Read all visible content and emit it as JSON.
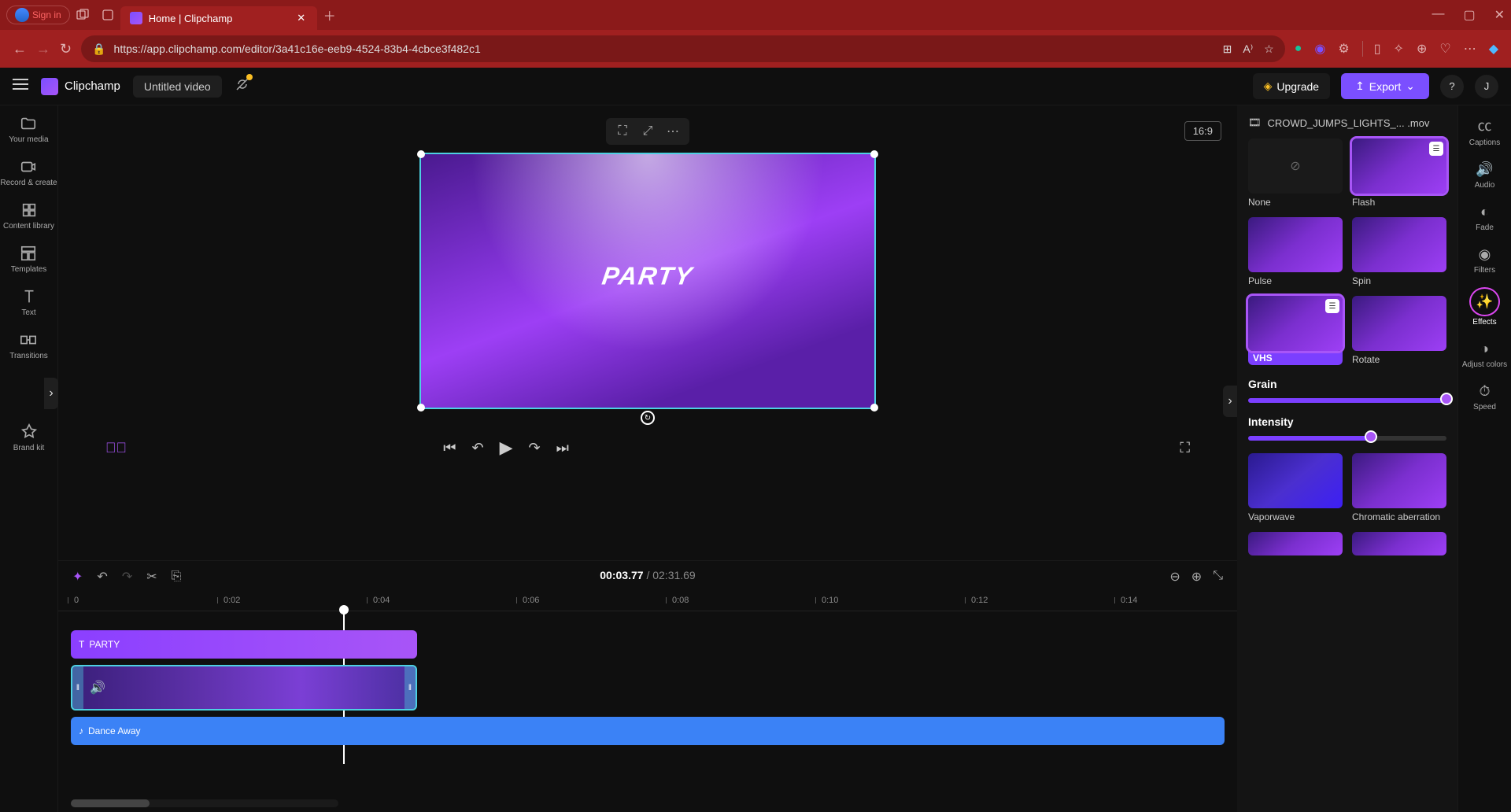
{
  "browser": {
    "signin": "Sign in",
    "tab_title": "Home | Clipchamp",
    "url": "https://app.clipchamp.com/editor/3a41c16e-eeb9-4524-83b4-4cbce3f482c1"
  },
  "header": {
    "brand": "Clipchamp",
    "project": "Untitled video",
    "upgrade": "Upgrade",
    "export": "Export",
    "user_initial": "J"
  },
  "left_nav": {
    "my_media": "Your media",
    "record": "Record & create",
    "content_lib": "Content library",
    "templates": "Templates",
    "text": "Text",
    "transitions": "Transitions",
    "brand_kit": "Brand kit"
  },
  "preview": {
    "aspect": "16:9",
    "overlay_text": "PARTY"
  },
  "timeline": {
    "current": "00:03.77",
    "total": "02:31.69",
    "ticks": [
      "0",
      "0:02",
      "0:04",
      "0:06",
      "0:08",
      "0:10",
      "0:12",
      "0:14"
    ],
    "text_clip": "PARTY",
    "audio_clip": "Dance Away"
  },
  "right_panel": {
    "clip_name": "CROWD_JUMPS_LIGHTS_... .mov",
    "effects": {
      "none": "None",
      "flash": "Flash",
      "pulse": "Pulse",
      "spin": "Spin",
      "vhs": "VHS",
      "rotate": "Rotate",
      "vaporwave": "Vaporwave",
      "chromatic": "Chromatic aberration"
    },
    "grain_label": "Grain",
    "grain_value": 100,
    "intensity_label": "Intensity",
    "intensity_value": 62
  },
  "right_rail": {
    "captions": "Captions",
    "audio": "Audio",
    "fade": "Fade",
    "filters": "Filters",
    "effects": "Effects",
    "adjust": "Adjust colors",
    "speed": "Speed"
  }
}
